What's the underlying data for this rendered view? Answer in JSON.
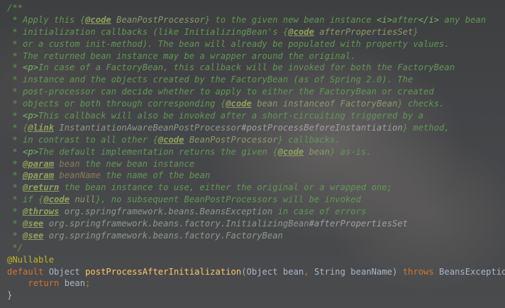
{
  "code_lines": [
    [
      {
        "t": "/**",
        "c": "doc"
      }
    ],
    [
      {
        "t": " * Apply this ",
        "c": "doc"
      },
      {
        "t": "{",
        "c": "doc"
      },
      {
        "t": "@code",
        "c": "tag"
      },
      {
        "t": " BeanPostProcessor",
        "c": "code"
      },
      {
        "t": "}",
        "c": "doc"
      },
      {
        "t": " to the given new bean instance ",
        "c": "doc"
      },
      {
        "t": "<i>",
        "c": "html"
      },
      {
        "t": "after",
        "c": "doc"
      },
      {
        "t": "</i>",
        "c": "html"
      },
      {
        "t": " any bean",
        "c": "doc"
      }
    ],
    [
      {
        "t": " * initialization callbacks (like InitializingBean's ",
        "c": "doc"
      },
      {
        "t": "{",
        "c": "doc"
      },
      {
        "t": "@code",
        "c": "tag"
      },
      {
        "t": " afterPropertiesSet",
        "c": "code"
      },
      {
        "t": "}",
        "c": "doc"
      }
    ],
    [
      {
        "t": " * or a custom init-method). The bean will already be populated with property values.",
        "c": "doc"
      }
    ],
    [
      {
        "t": " * The returned bean instance may be a wrapper around the original.",
        "c": "doc"
      }
    ],
    [
      {
        "t": " * ",
        "c": "doc"
      },
      {
        "t": "<p>",
        "c": "html"
      },
      {
        "t": "In case of a FactoryBean, this callback will be invoked for both the FactoryBean",
        "c": "doc"
      }
    ],
    [
      {
        "t": " * instance and the objects created by the FactoryBean (as of Spring 2.0). The",
        "c": "doc"
      }
    ],
    [
      {
        "t": " * post-processor can decide whether to apply to either the FactoryBean or created",
        "c": "doc"
      }
    ],
    [
      {
        "t": " * objects or both through corresponding ",
        "c": "doc"
      },
      {
        "t": "{",
        "c": "doc"
      },
      {
        "t": "@code",
        "c": "tag"
      },
      {
        "t": " bean instanceof FactoryBean",
        "c": "code"
      },
      {
        "t": "}",
        "c": "doc"
      },
      {
        "t": " checks.",
        "c": "doc"
      }
    ],
    [
      {
        "t": " * ",
        "c": "doc"
      },
      {
        "t": "<p>",
        "c": "html"
      },
      {
        "t": "This callback will also be invoked after a short-circuiting triggered by a",
        "c": "doc"
      }
    ],
    [
      {
        "t": " * ",
        "c": "doc"
      },
      {
        "t": "{",
        "c": "doc"
      },
      {
        "t": "@link",
        "c": "tag"
      },
      {
        "t": " InstantiationAwareBeanPostProcessor",
        "c": "cref"
      },
      {
        "t": "#postProcessBeforeInstantiation",
        "c": "tagref"
      },
      {
        "t": "}",
        "c": "doc"
      },
      {
        "t": " method,",
        "c": "doc"
      }
    ],
    [
      {
        "t": " * in contrast to all other ",
        "c": "doc"
      },
      {
        "t": "{",
        "c": "doc"
      },
      {
        "t": "@code",
        "c": "tag"
      },
      {
        "t": " BeanPostProcessor",
        "c": "code"
      },
      {
        "t": "}",
        "c": "doc"
      },
      {
        "t": " callbacks.",
        "c": "doc"
      }
    ],
    [
      {
        "t": " * ",
        "c": "doc"
      },
      {
        "t": "<p>",
        "c": "html"
      },
      {
        "t": "The default implementation returns the given ",
        "c": "doc"
      },
      {
        "t": "{",
        "c": "doc"
      },
      {
        "t": "@code",
        "c": "tag"
      },
      {
        "t": " bean",
        "c": "code"
      },
      {
        "t": "}",
        "c": "doc"
      },
      {
        "t": " as-is.",
        "c": "doc"
      }
    ],
    [
      {
        "t": " * ",
        "c": "doc"
      },
      {
        "t": "@param",
        "c": "tag"
      },
      {
        "t": " bean",
        "c": "pval"
      },
      {
        "t": " the new bean instance",
        "c": "doc"
      }
    ],
    [
      {
        "t": " * ",
        "c": "doc"
      },
      {
        "t": "@param",
        "c": "tag"
      },
      {
        "t": " beanName",
        "c": "pval"
      },
      {
        "t": " the name of the bean",
        "c": "doc"
      }
    ],
    [
      {
        "t": " * ",
        "c": "doc"
      },
      {
        "t": "@return",
        "c": "tag"
      },
      {
        "t": " the bean instance to use, either the original or a wrapped one;",
        "c": "doc"
      }
    ],
    [
      {
        "t": " * if ",
        "c": "doc"
      },
      {
        "t": "{",
        "c": "doc"
      },
      {
        "t": "@code",
        "c": "tag"
      },
      {
        "t": " null",
        "c": "code"
      },
      {
        "t": "}",
        "c": "doc"
      },
      {
        "t": ", no subsequent BeanPostProcessors will be invoked",
        "c": "doc"
      }
    ],
    [
      {
        "t": " * ",
        "c": "doc"
      },
      {
        "t": "@throws",
        "c": "tag"
      },
      {
        "t": " org.springframework.beans.BeansException",
        "c": "cref"
      },
      {
        "t": " in case of errors",
        "c": "doc"
      }
    ],
    [
      {
        "t": " * ",
        "c": "doc"
      },
      {
        "t": "@see",
        "c": "tag"
      },
      {
        "t": " org.springframework.beans.factory.InitializingBean",
        "c": "cref"
      },
      {
        "t": "#afterPropertiesSet",
        "c": "tagref"
      }
    ],
    [
      {
        "t": " * ",
        "c": "doc"
      },
      {
        "t": "@see",
        "c": "tag"
      },
      {
        "t": " org.springframework.beans.factory.FactoryBean",
        "c": "cref"
      }
    ],
    [
      {
        "t": " */",
        "c": "doc"
      }
    ],
    [
      {
        "t": "@Nullable",
        "c": "ann"
      }
    ],
    [
      {
        "t": "default",
        "c": "kw"
      },
      {
        "t": " Object ",
        "c": "plain"
      },
      {
        "t": "postProcessAfterInitialization",
        "c": "fn"
      },
      {
        "t": "(Object bean",
        "c": "plain"
      },
      {
        "t": ",",
        "c": "kw"
      },
      {
        "t": " String beanName) ",
        "c": "plain"
      },
      {
        "t": "throws",
        "c": "kw"
      },
      {
        "t": " BeansException {",
        "c": "plain"
      }
    ],
    [
      {
        "t": "    ",
        "c": "plain"
      },
      {
        "t": "return",
        "c": "kw"
      },
      {
        "t": " bean",
        "c": "plain"
      },
      {
        "t": ";",
        "c": "kw"
      }
    ],
    [
      {
        "t": "}",
        "c": "plain"
      }
    ]
  ]
}
